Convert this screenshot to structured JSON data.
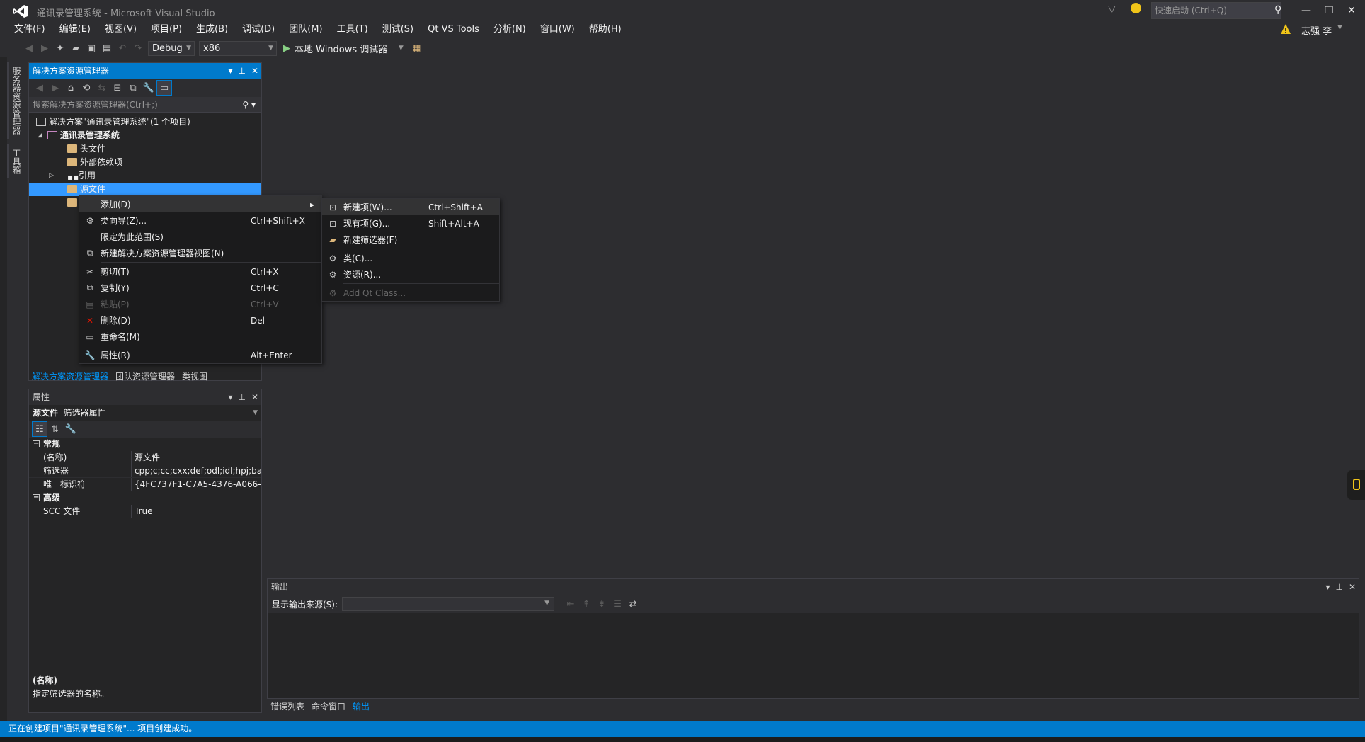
{
  "window": {
    "title": "通讯录管理系统 - Microsoft Visual Studio",
    "quick_launch_placeholder": "快速启动 (Ctrl+Q)",
    "user_name": "志强 李",
    "minimize": "—",
    "restore": "❐",
    "close": "✕"
  },
  "menubar": [
    "文件(F)",
    "编辑(E)",
    "视图(V)",
    "项目(P)",
    "生成(B)",
    "调试(D)",
    "团队(M)",
    "工具(T)",
    "测试(S)",
    "Qt VS Tools",
    "分析(N)",
    "窗口(W)",
    "帮助(H)"
  ],
  "toolbar": {
    "config": "Debug",
    "platform": "x86",
    "run_label": "本地 Windows 调试器"
  },
  "side_tabs": [
    "服务器资源管理器",
    "工具箱"
  ],
  "solution_explorer": {
    "title": "解决方案资源管理器",
    "search_placeholder": "搜索解决方案资源管理器(Ctrl+;)",
    "tree": [
      {
        "label": "解决方案\"通讯录管理系统\"(1 个项目)"
      },
      {
        "label": "通讯录管理系统"
      },
      {
        "label": "头文件"
      },
      {
        "label": "外部依赖项"
      },
      {
        "label": "引用"
      },
      {
        "label": "源文件"
      },
      {
        "label": ""
      }
    ],
    "bottom_tabs": [
      "解决方案资源管理器",
      "团队资源管理器",
      "类视图"
    ]
  },
  "context_menu": {
    "items": [
      {
        "label": "添加(D)",
        "shortcut": "",
        "icon": "",
        "submenu": "▸"
      },
      {
        "label": "类向导(Z)...",
        "shortcut": "Ctrl+Shift+X",
        "icon": "class-wizard-icon"
      },
      {
        "label": "限定为此范围(S)",
        "shortcut": ""
      },
      {
        "label": "新建解决方案资源管理器视图(N)",
        "shortcut": "",
        "icon": "new-view-icon"
      },
      {
        "label": "剪切(T)",
        "shortcut": "Ctrl+X",
        "icon": "cut-icon"
      },
      {
        "label": "复制(Y)",
        "shortcut": "Ctrl+C",
        "icon": "copy-icon"
      },
      {
        "label": "粘贴(P)",
        "shortcut": "Ctrl+V",
        "icon": "paste-icon"
      },
      {
        "label": "删除(D)",
        "shortcut": "Del",
        "icon": "delete-icon"
      },
      {
        "label": "重命名(M)",
        "shortcut": "",
        "icon": "rename-icon"
      },
      {
        "label": "属性(R)",
        "shortcut": "Alt+Enter",
        "icon": "properties-icon"
      }
    ]
  },
  "submenu": {
    "items": [
      {
        "label": "新建项(W)...",
        "shortcut": "Ctrl+Shift+A"
      },
      {
        "label": "现有项(G)...",
        "shortcut": "Shift+Alt+A"
      },
      {
        "label": "新建筛选器(F)",
        "shortcut": ""
      },
      {
        "label": "类(C)...",
        "shortcut": ""
      },
      {
        "label": "资源(R)...",
        "shortcut": ""
      },
      {
        "label": "Add Qt Class...",
        "shortcut": ""
      }
    ]
  },
  "properties": {
    "title": "属性",
    "object_name": "源文件",
    "object_type": "筛选器属性",
    "categories": [
      {
        "name": "常规",
        "rows": [
          {
            "name": "(名称)",
            "value": "源文件"
          },
          {
            "name": "筛选器",
            "value": "cpp;c;cc;cxx;def;odl;idl;hpj;ba"
          },
          {
            "name": "唯一标识符",
            "value": "{4FC737F1-C7A5-4376-A066-"
          }
        ]
      },
      {
        "name": "高级",
        "rows": [
          {
            "name": "SCC 文件",
            "value": "True"
          }
        ]
      }
    ],
    "desc_title": "(名称)",
    "desc_text": "指定筛选器的名称。"
  },
  "output": {
    "title": "输出",
    "source_label": "显示输出来源(S):",
    "tabs": [
      "错误列表",
      "命令窗口",
      "输出"
    ]
  },
  "status": {
    "text": "正在创建项目\"通讯录管理系统\"... 项目创建成功。"
  },
  "colors": {
    "accent": "#007acc",
    "selection": "#3399ff",
    "background": "#2d2d30"
  }
}
